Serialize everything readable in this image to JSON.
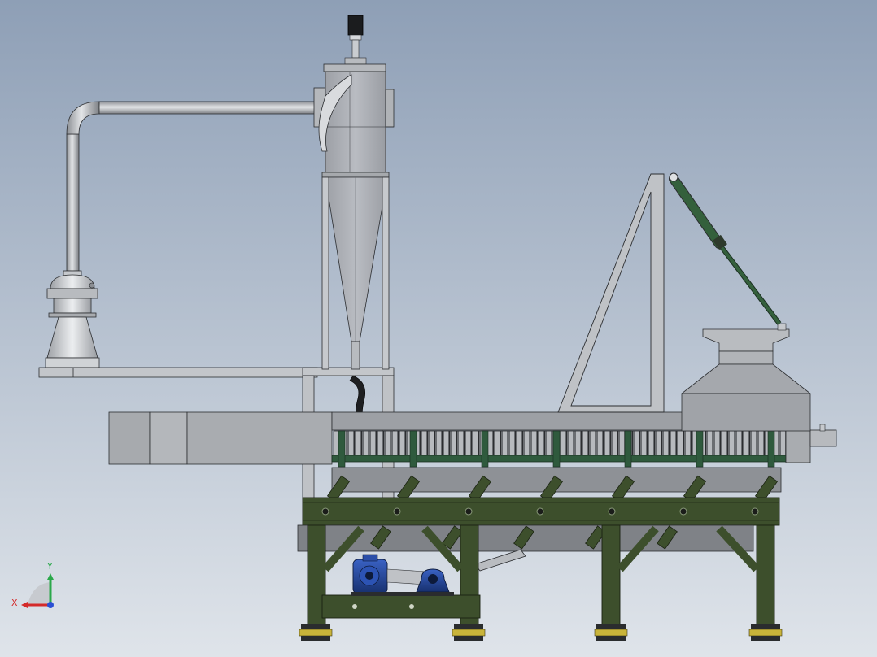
{
  "view": {
    "background_top": "#8e9fb6",
    "background_bottom": "#dfe4ea"
  },
  "colors": {
    "metal_light": "#c9ccd0",
    "metal_mid": "#a8abaf",
    "metal_dark": "#8b8e93",
    "edge": "#2b2d30",
    "frame_green": "#3d4f2c",
    "frame_green_dark": "#26331b",
    "chain_green": "#2f5a3d",
    "cylinder_green": "#34603c",
    "motor_blue": "#1f3f8f",
    "foot_yellow": "#c9b43a"
  },
  "axis_triad": {
    "x_label": "X",
    "y_label": "Y",
    "x_color": "#d42a2a",
    "y_color": "#2aa84a",
    "z_color": "#2a4fd4"
  }
}
